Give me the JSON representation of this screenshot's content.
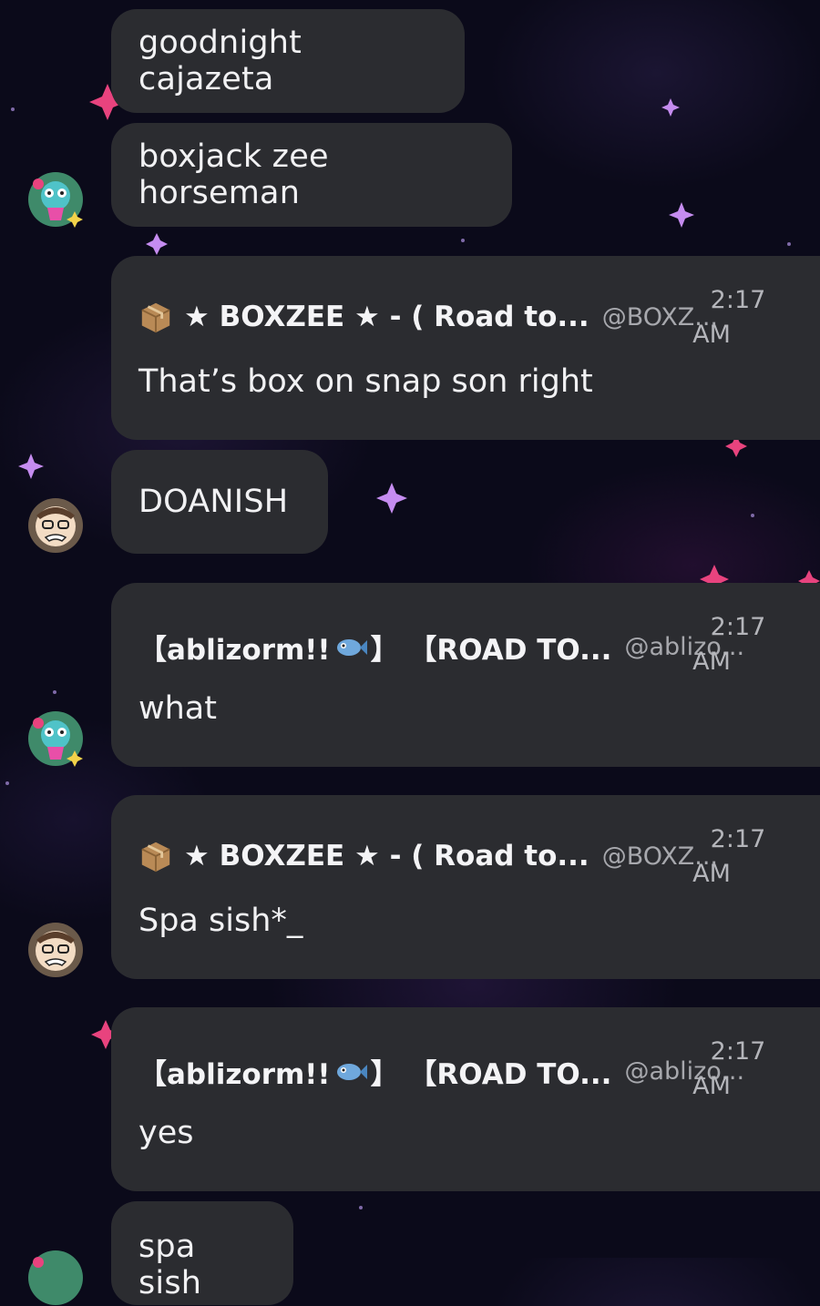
{
  "messages": [
    {
      "type": "simple",
      "text": "goodnight cajazeta"
    },
    {
      "type": "simple",
      "text": "boxjack zee horseman"
    },
    {
      "type": "rich",
      "name": "★ BOXZEE ★ - ( Road to...",
      "handle": "@BOXZ...",
      "time": "2:17",
      "ampm": "AM",
      "text": "That’s box on snap son right"
    },
    {
      "type": "simple",
      "text": "DOANISH"
    },
    {
      "type": "rich",
      "name_part1": "【ablizorm!!",
      "name_part2": "】 【ROAD TO...",
      "handle": "@ablizo...",
      "time": "2:17",
      "ampm": "AM",
      "text": "what"
    },
    {
      "type": "rich",
      "name": "★ BOXZEE ★ - ( Road to...",
      "handle": "@BOXZ...",
      "time": "2:17",
      "ampm": "AM",
      "text": "Spa sish*_"
    },
    {
      "type": "rich",
      "name_part1": "【ablizorm!!",
      "name_part2": "】 【ROAD TO...",
      "handle": "@ablizo...",
      "time": "2:17",
      "ampm": "AM",
      "text": "yes"
    },
    {
      "type": "simple",
      "text": "spa sish"
    }
  ],
  "icons": {
    "box": "package-icon",
    "fish": "fish-icon"
  },
  "colors": {
    "background": "#0b0a1a",
    "bubble": "#2b2c30",
    "text": "#f1f1f3",
    "muted": "#a7a8ad",
    "sparkle_pink": "#e8437e",
    "sparkle_violet": "#b58be8"
  }
}
